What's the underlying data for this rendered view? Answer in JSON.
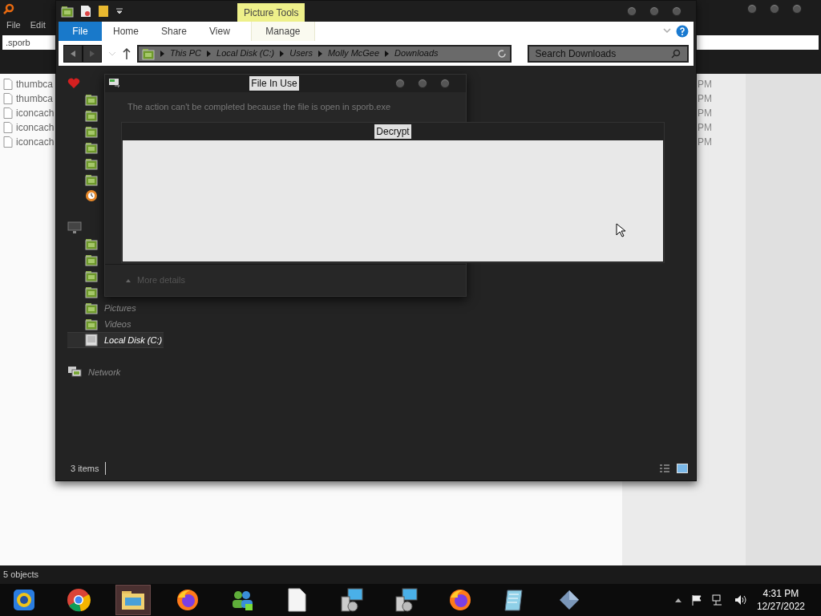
{
  "background_app": {
    "menu": [
      "File",
      "Edit"
    ],
    "search_value": ".sporb",
    "files": [
      {
        "name": "thumbca",
        "time": "PM"
      },
      {
        "name": "thumbca",
        "time": "PM"
      },
      {
        "name": "iconcach",
        "time": "PM"
      },
      {
        "name": "iconcach",
        "time": "PM"
      },
      {
        "name": "iconcach",
        "time": "PM"
      }
    ],
    "status": "5 objects"
  },
  "explorer": {
    "context_tab": "Picture Tools",
    "ribbon_tabs": [
      {
        "label": "File",
        "selected": true
      },
      {
        "label": "Home",
        "selected": false
      },
      {
        "label": "Share",
        "selected": false
      },
      {
        "label": "View",
        "selected": false
      },
      {
        "label": "Manage",
        "selected": false
      }
    ],
    "breadcrumbs": [
      "This PC",
      "Local Disk (C:)",
      "Users",
      "Molly McGee",
      "Downloads"
    ],
    "search_placeholder": "Search Downloads",
    "nav_sections": [
      {
        "kind": "favorites",
        "items": [
          {
            "kind": "folder",
            "selected": false
          },
          {
            "kind": "folder",
            "selected": false
          },
          {
            "kind": "folder",
            "selected": false
          },
          {
            "kind": "folder",
            "selected": false
          },
          {
            "kind": "folder",
            "selected": false
          },
          {
            "kind": "folder",
            "selected": false
          },
          {
            "kind": "recent",
            "selected": false
          }
        ]
      },
      {
        "kind": "pc",
        "items": [
          {
            "kind": "folder",
            "selected": false
          },
          {
            "kind": "folder",
            "selected": false
          },
          {
            "kind": "folder",
            "selected": false
          },
          {
            "kind": "folder",
            "selected": false
          },
          {
            "kind": "folder",
            "label": "Pictures",
            "selected": false
          },
          {
            "kind": "folder",
            "label": "Videos",
            "selected": false
          },
          {
            "kind": "disk",
            "label": "Local Disk (C:)",
            "selected": true
          }
        ]
      },
      {
        "kind": "network",
        "label": "Network"
      }
    ],
    "status": "3 items"
  },
  "file_in_use_dialog": {
    "title": "File In Use",
    "message": "The action can't be completed because the file is open in sporb.exe",
    "more_details": "More details"
  },
  "decrypt_window": {
    "title": "Decrypt"
  },
  "taskbar": {
    "apps": [
      {
        "kind": "media",
        "active": false
      },
      {
        "kind": "chrome",
        "active": false
      },
      {
        "kind": "explorer",
        "active": true
      },
      {
        "kind": "firefox",
        "active": false
      },
      {
        "kind": "people",
        "active": false
      },
      {
        "kind": "file",
        "active": false
      },
      {
        "kind": "installer",
        "active": false
      },
      {
        "kind": "installer",
        "active": false
      },
      {
        "kind": "firefox",
        "active": false
      },
      {
        "kind": "notepad",
        "active": false
      },
      {
        "kind": "diamond",
        "active": false
      }
    ],
    "time": "4:31 PM",
    "date": "12/27/2022"
  }
}
